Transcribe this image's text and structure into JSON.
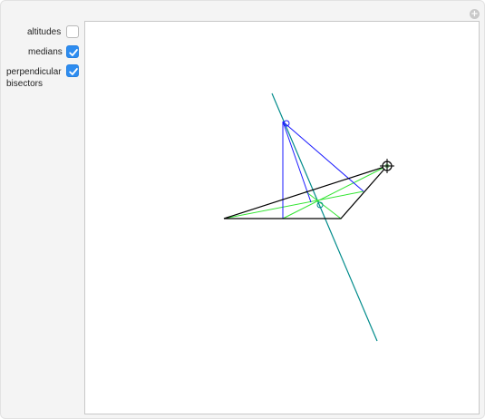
{
  "controls": [
    {
      "label": "altitudes",
      "checked": false
    },
    {
      "label": "medians",
      "checked": true
    },
    {
      "label_lines": [
        "perpendicular",
        "bisectors"
      ],
      "checked": true
    }
  ],
  "colors": {
    "checkbox_on": "#2d8cf0",
    "triangle": "#000000",
    "medians": "#33e533",
    "perpendicular_bisectors": "#1a1aff",
    "euler_line": "#008b8b"
  },
  "icons": {
    "add": "plus-circle-icon",
    "locator": "crosshair-locator-icon"
  }
}
